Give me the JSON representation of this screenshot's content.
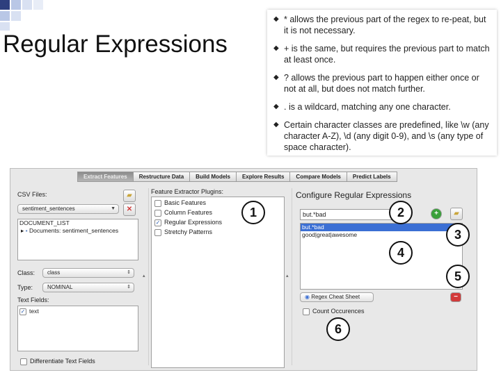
{
  "slide": {
    "title": "Regular Expressions"
  },
  "bullets": [
    "* allows the previous part of the regex to re-peat, but it is not necessary.",
    "+ is the same, but requires the previous part to match at least once.",
    "? allows the previous part to happen either once or not at all, but does not match further.",
    ". is a wildcard, matching any one character.",
    "Certain character classes are predefined, like \\w (any character A-Z), \\d (any digit 0-9), and \\s (any type of space character)."
  ],
  "tabs": [
    "Extract Features",
    "Restructure Data",
    "Build Models",
    "Explore Results",
    "Compare Models",
    "Predict Labels"
  ],
  "left": {
    "csv_label": "CSV Files:",
    "csv_select": "sentiment_sentences",
    "tree_root": "DOCUMENT_LIST",
    "tree_child": "Documents: sentiment_sentences",
    "class_label": "Class:",
    "class_value": "class",
    "type_label": "Type:",
    "type_value": "NOMINAL",
    "text_fields_label": "Text Fields:",
    "text_field_item": "text",
    "differentiate_label": "Differentiate Text Fields"
  },
  "plugins": {
    "label": "Feature Extractor Plugins:",
    "items": [
      {
        "label": "Basic Features",
        "checked": false
      },
      {
        "label": "Column Features",
        "checked": false
      },
      {
        "label": "Regular Expressions",
        "checked": true
      },
      {
        "label": "Stretchy Patterns",
        "checked": false
      }
    ]
  },
  "configure": {
    "title": "Configure Regular Expressions",
    "input_value": "but.*bad",
    "list": [
      {
        "text": "but.*bad",
        "selected": true
      },
      {
        "text": "good|great|awesome",
        "selected": false
      }
    ],
    "cheat_sheet_label": "Regex Cheat Sheet",
    "count_label": "Count Occurences"
  },
  "callouts": [
    "1",
    "2",
    "3",
    "4",
    "5",
    "6"
  ],
  "colors": {
    "accent": "#3b6fd4",
    "corner": "#b9c7e6",
    "remove": "#d23a3a",
    "add": "#3aa03a"
  }
}
